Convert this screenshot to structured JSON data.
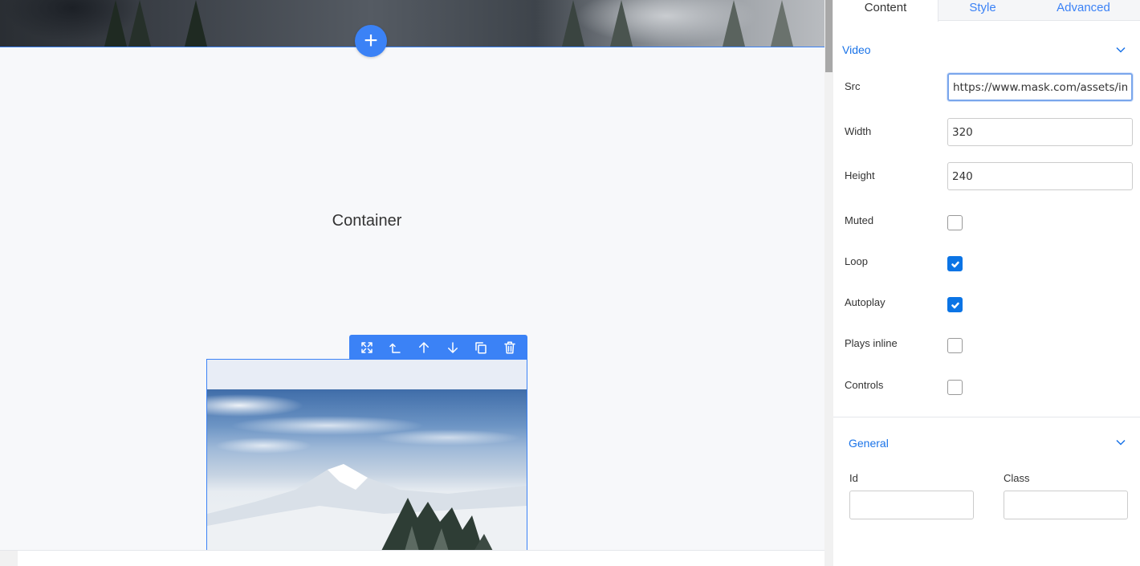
{
  "canvas": {
    "add_button_symbol": "+",
    "container_label": "Container",
    "toolbar": {
      "icons": [
        "fullscreen-icon",
        "select-parent-icon",
        "move-up-icon",
        "move-down-icon",
        "copy-icon",
        "delete-icon"
      ]
    }
  },
  "panel": {
    "tabs": [
      {
        "label": "Content",
        "active": true
      },
      {
        "label": "Style",
        "active": false
      },
      {
        "label": "Advanced",
        "active": false
      }
    ],
    "video_section": {
      "title": "Video",
      "src_label": "Src",
      "src_value": "https://www.mask.com/assets/im",
      "width_label": "Width",
      "width_value": "320",
      "height_label": "Height",
      "height_value": "240",
      "muted_label": "Muted",
      "muted_checked": false,
      "loop_label": "Loop",
      "loop_checked": true,
      "autoplay_label": "Autoplay",
      "autoplay_checked": true,
      "plays_inline_label": "Plays inline",
      "plays_inline_checked": false,
      "controls_label": "Controls",
      "controls_checked": false
    },
    "general_section": {
      "title": "General",
      "id_label": "Id",
      "id_value": "",
      "class_label": "Class",
      "class_value": ""
    }
  },
  "colors": {
    "accent": "#3b82f6",
    "link": "#1a73e8",
    "checkbox_checked": "#0b74e5",
    "canvas_bg": "#f7f8fa"
  }
}
